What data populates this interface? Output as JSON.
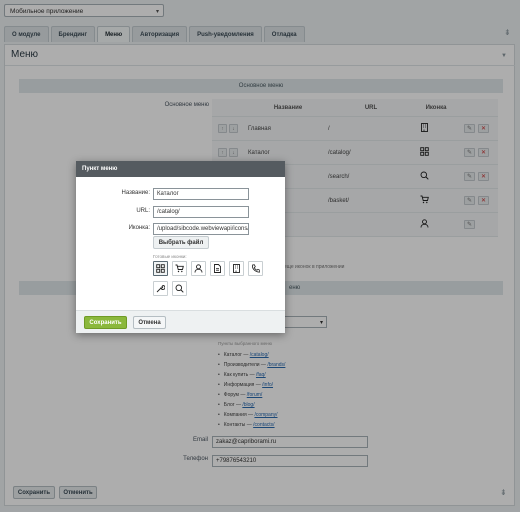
{
  "app_select": {
    "value": "Мобильное приложение"
  },
  "tabs": [
    {
      "label": "О модуле",
      "active": false
    },
    {
      "label": "Брендинг",
      "active": false
    },
    {
      "label": "Меню",
      "active": true
    },
    {
      "label": "Авторизация",
      "active": false
    },
    {
      "label": "Push-уведомления",
      "active": false
    },
    {
      "label": "Отладка",
      "active": false
    }
  ],
  "card": {
    "title": "Меню"
  },
  "sections": {
    "main_menu": "Основное меню",
    "second": "еню"
  },
  "main_menu_label": "Основное меню",
  "table": {
    "headers": {
      "name": "Название",
      "url": "URL",
      "icon": "Иконка"
    },
    "rows": [
      {
        "name": "Главная",
        "url": "/",
        "icon": "building-icon"
      },
      {
        "name": "Каталог",
        "url": "/catalog/",
        "icon": "grid-icon"
      },
      {
        "name": "",
        "url": "/search/",
        "icon": "search-icon"
      },
      {
        "name": "",
        "url": "/basket/",
        "icon": "cart-icon"
      },
      {
        "name": "",
        "url": "",
        "icon": "user-icon"
      }
    ]
  },
  "hint_text": "еще иконок в приложении",
  "pages": {
    "title": "Пункты выбранного меню",
    "items": [
      {
        "label": "Каталог",
        "link": "/catalog/"
      },
      {
        "label": "Производители",
        "link": "/brands/"
      },
      {
        "label": "Как купить",
        "link": "/faq/"
      },
      {
        "label": "Информация",
        "link": "/info/"
      },
      {
        "label": "Форум",
        "link": "/forum/"
      },
      {
        "label": "Блог",
        "link": "/blog/"
      },
      {
        "label": "Компания",
        "link": "/company/"
      },
      {
        "label": "Контакты",
        "link": "/contacts/"
      }
    ]
  },
  "contacts": {
    "email_label": "Email",
    "email_value": "zakaz@capriborami.ru",
    "phone_label": "Телефон",
    "phone_value": "+79876543210"
  },
  "footer": {
    "save": "Сохранить",
    "cancel": "Отменить"
  },
  "modal": {
    "title": "Пункт меню",
    "name_label": "Название:",
    "name_value": "Каталог",
    "url_label": "URL:",
    "url_value": "/catalog/",
    "icon_label": "Иконка:",
    "icon_value": "/upload/sibcode.webviewapi/icons/",
    "choose_file": "Выбрать файл",
    "ready_icons_label": "Готовые иконки:",
    "icons": [
      "grid-icon",
      "cart-icon",
      "user-icon",
      "document-icon",
      "building-icon",
      "phone-icon",
      "wrench-icon",
      "search-icon"
    ],
    "save": "Сохранить",
    "cancel": "Отмена"
  },
  "colors": {
    "accent": "#8bb83c",
    "modal_header": "#555b60",
    "delete": "#cc3333"
  }
}
